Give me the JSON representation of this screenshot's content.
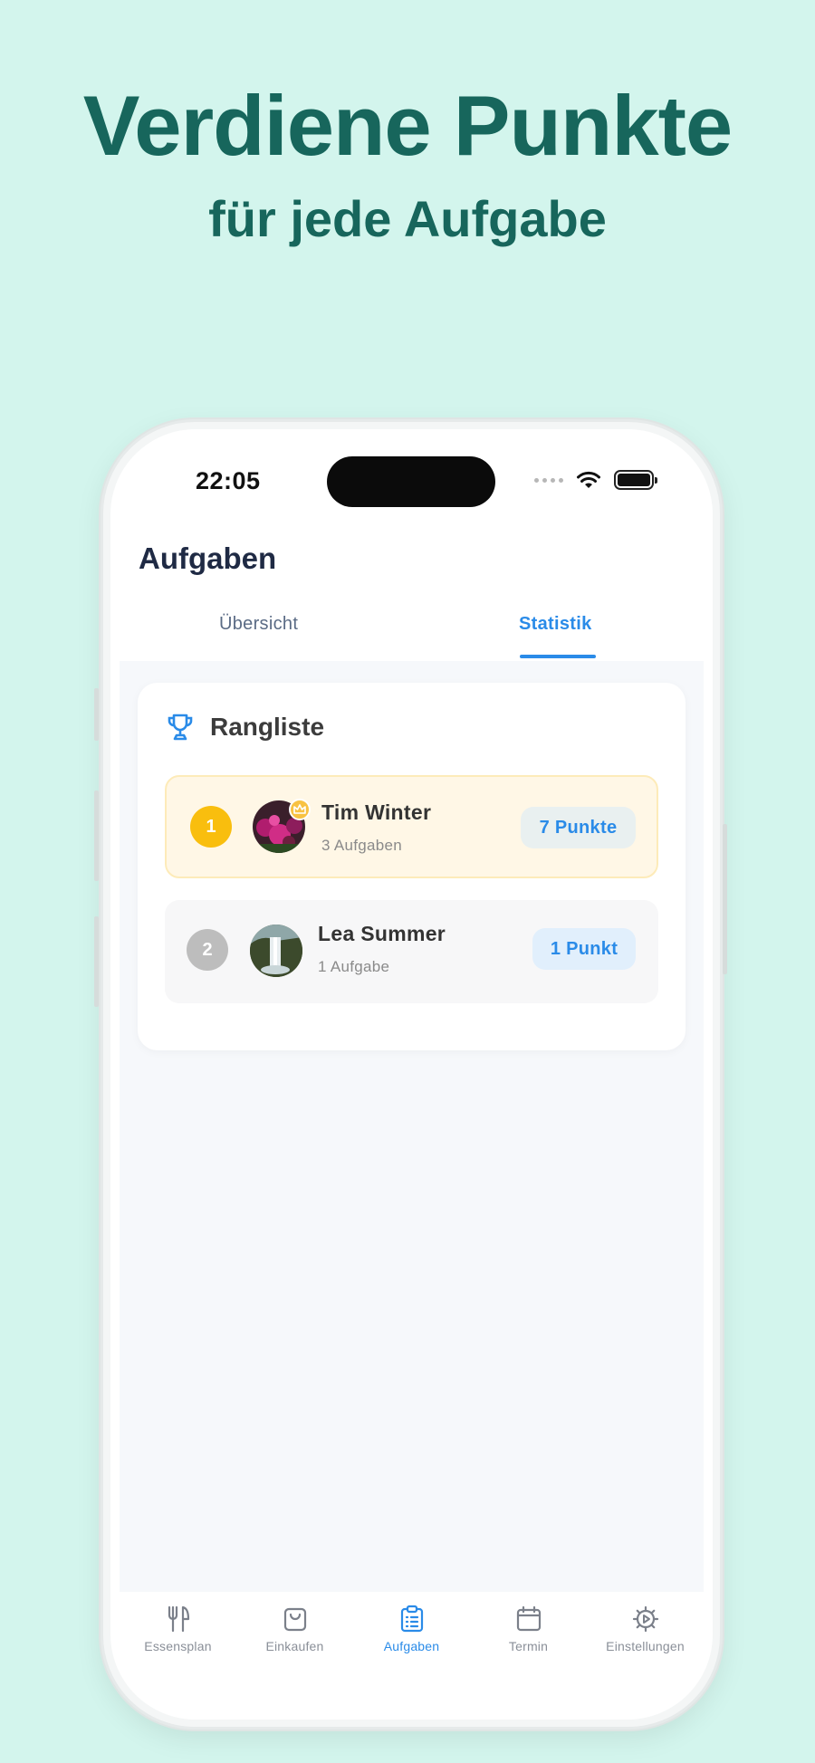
{
  "promo": {
    "headline": "Verdiene Punkte",
    "subline": "für jede Aufgabe"
  },
  "status_bar": {
    "time": "22:05"
  },
  "header": {
    "title": "Aufgaben"
  },
  "tabs": [
    {
      "label": "Übersicht",
      "active": false
    },
    {
      "label": "Statistik",
      "active": true
    }
  ],
  "leaderboard": {
    "title": "Rangliste",
    "entries": [
      {
        "rank": "1",
        "name": "Tim Winter",
        "tasks": "3 Aufgaben",
        "points": "7 Punkte"
      },
      {
        "rank": "2",
        "name": "Lea Summer",
        "tasks": "1 Aufgabe",
        "points": "1 Punkt"
      }
    ]
  },
  "bottom_nav": [
    {
      "label": "Essensplan",
      "icon": "fork-knife-icon",
      "active": false
    },
    {
      "label": "Einkaufen",
      "icon": "shopping-bag-icon",
      "active": false
    },
    {
      "label": "Aufgaben",
      "icon": "clipboard-list-icon",
      "active": true
    },
    {
      "label": "Termin",
      "icon": "calendar-icon",
      "active": false
    },
    {
      "label": "Einstellungen",
      "icon": "gear-icon",
      "active": false
    }
  ],
  "colors": {
    "background": "#d3f5ed",
    "headline": "#17665c",
    "accent": "#2a8be8",
    "gold": "#f9be0e",
    "silver": "#bdbdbd"
  }
}
